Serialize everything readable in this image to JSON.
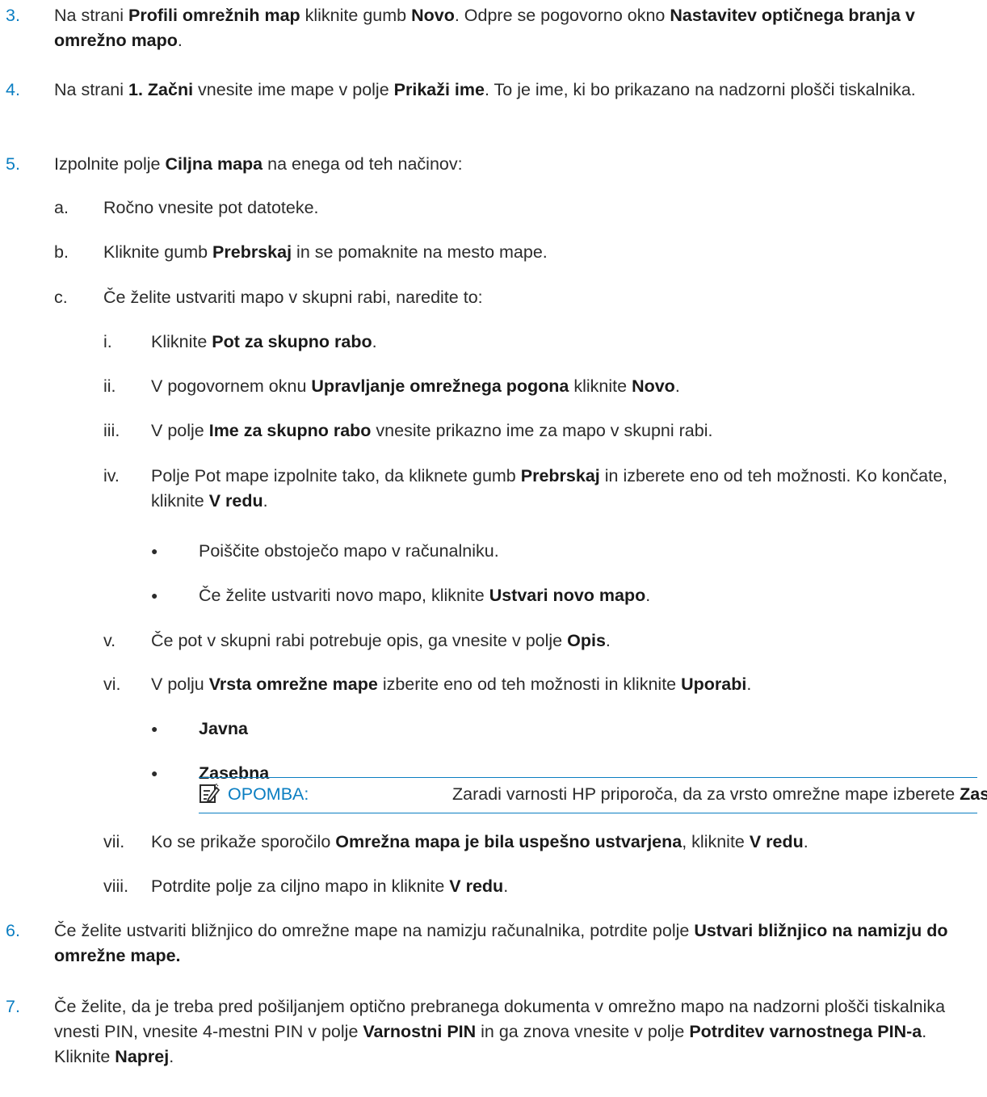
{
  "steps": [
    {
      "num": "3.",
      "parts": [
        [
          "Na strani ",
          0
        ],
        [
          "Profili omrežnih map",
          1
        ],
        [
          " kliknite gumb ",
          0
        ],
        [
          "Novo",
          1
        ],
        [
          ". Odpre se pogovorno okno ",
          0
        ],
        [
          "Nastavitev optičnega branja v omrežno mapo",
          1
        ],
        [
          ".",
          0
        ]
      ]
    },
    {
      "num": "4.",
      "parts": [
        [
          "Na strani ",
          0
        ],
        [
          "1. Začni",
          1
        ],
        [
          " vnesite ime mape v polje ",
          0
        ],
        [
          "Prikaži ime",
          1
        ],
        [
          ". To je ime, ki bo prikazano na nadzorni plošči tiskalnika.",
          0
        ]
      ]
    },
    {
      "num": "5.",
      "parts": [
        [
          "Izpolnite polje ",
          0
        ],
        [
          "Ciljna mapa",
          1
        ],
        [
          " na enega od teh načinov:",
          0
        ]
      ]
    },
    {
      "num": "a.",
      "parts": [
        [
          "Ročno vnesite pot datoteke.",
          0
        ]
      ]
    },
    {
      "num": "b.",
      "parts": [
        [
          "Kliknite gumb ",
          0
        ],
        [
          "Prebrskaj",
          1
        ],
        [
          " in se pomaknite na mesto mape.",
          0
        ]
      ]
    },
    {
      "num": "c.",
      "parts": [
        [
          "Če želite ustvariti mapo v skupni rabi, naredite to:",
          0
        ]
      ]
    },
    {
      "num": "i.",
      "parts": [
        [
          "Kliknite ",
          0
        ],
        [
          "Pot za skupno rabo",
          1
        ],
        [
          ".",
          0
        ]
      ]
    },
    {
      "num": "ii.",
      "parts": [
        [
          "V pogovornem oknu ",
          0
        ],
        [
          "Upravljanje omrežnega pogona",
          1
        ],
        [
          " kliknite ",
          0
        ],
        [
          "Novo",
          1
        ],
        [
          ".",
          0
        ]
      ]
    },
    {
      "num": "iii.",
      "parts": [
        [
          "V polje ",
          0
        ],
        [
          "Ime za skupno rabo",
          1
        ],
        [
          " vnesite prikazno ime za mapo v skupni rabi.",
          0
        ]
      ]
    },
    {
      "num": "iv.",
      "parts": [
        [
          "Polje Pot mape izpolnite tako, da kliknete gumb ",
          0
        ],
        [
          "Prebrskaj",
          1
        ],
        [
          " in izberete eno od teh možnosti. Ko končate, kliknite ",
          0
        ],
        [
          "V redu",
          1
        ],
        [
          ".",
          0
        ]
      ]
    },
    {
      "num": "●",
      "parts": [
        [
          "Poiščite obstoječo mapo v računalniku.",
          0
        ]
      ]
    },
    {
      "num": "●",
      "parts": [
        [
          "Če želite ustvariti novo mapo, kliknite ",
          0
        ],
        [
          "Ustvari novo mapo",
          1
        ],
        [
          ".",
          0
        ]
      ]
    },
    {
      "num": "v.",
      "parts": [
        [
          "Če pot v skupni rabi potrebuje opis, ga vnesite v polje ",
          0
        ],
        [
          "Opis",
          1
        ],
        [
          ".",
          0
        ]
      ]
    },
    {
      "num": "vi.",
      "parts": [
        [
          "V polju ",
          0
        ],
        [
          "Vrsta omrežne mape",
          1
        ],
        [
          " izberite eno od teh možnosti in kliknite ",
          0
        ],
        [
          "Uporabi",
          1
        ],
        [
          ".",
          0
        ]
      ]
    },
    {
      "num": "●",
      "parts": [
        [
          "Javna",
          1
        ]
      ]
    },
    {
      "num": "●",
      "parts": [
        [
          "Zasebna",
          1
        ]
      ]
    },
    {
      "num": "vii.",
      "parts": [
        [
          "Ko se prikaže sporočilo ",
          0
        ],
        [
          "Omrežna mapa je bila uspešno ustvarjena",
          1
        ],
        [
          ", kliknite ",
          0
        ],
        [
          "V redu",
          1
        ],
        [
          ".",
          0
        ]
      ]
    },
    {
      "num": "viii.",
      "parts": [
        [
          "Potrdite polje za ciljno mapo in kliknite ",
          0
        ],
        [
          "V redu",
          1
        ],
        [
          ".",
          0
        ]
      ]
    },
    {
      "num": "6.",
      "parts": [
        [
          "Če želite ustvariti bližnjico do omrežne mape na namizju računalnika, potrdite polje ",
          0
        ],
        [
          "Ustvari bližnjico na namizju do omrežne mape.",
          1
        ]
      ]
    },
    {
      "num": "7.",
      "parts": [
        [
          "Če želite, da je treba pred pošiljanjem optično prebranega dokumenta v omrežno mapo na nadzorni plošči tiskalnika vnesti PIN, vnesite 4-mestni PIN v polje ",
          0
        ],
        [
          "Varnostni PIN",
          1
        ],
        [
          " in ga znova vnesite v polje ",
          0
        ],
        [
          "Potrditev varnostnega PIN-a",
          1
        ],
        [
          ". Kliknite ",
          0
        ],
        [
          "Naprej",
          1
        ],
        [
          ".",
          0
        ]
      ]
    }
  ],
  "note": {
    "label": "OPOMBA:",
    "text_before": "Zaradi varnosti HP priporoča, da za vrsto omrežne mape izberete ",
    "text_bold": "Zasebna",
    "text_after": ".",
    "icon": "note-pencil-icon"
  },
  "colors": {
    "accent": "#0a7ec2",
    "text": "#2b2b2b"
  }
}
